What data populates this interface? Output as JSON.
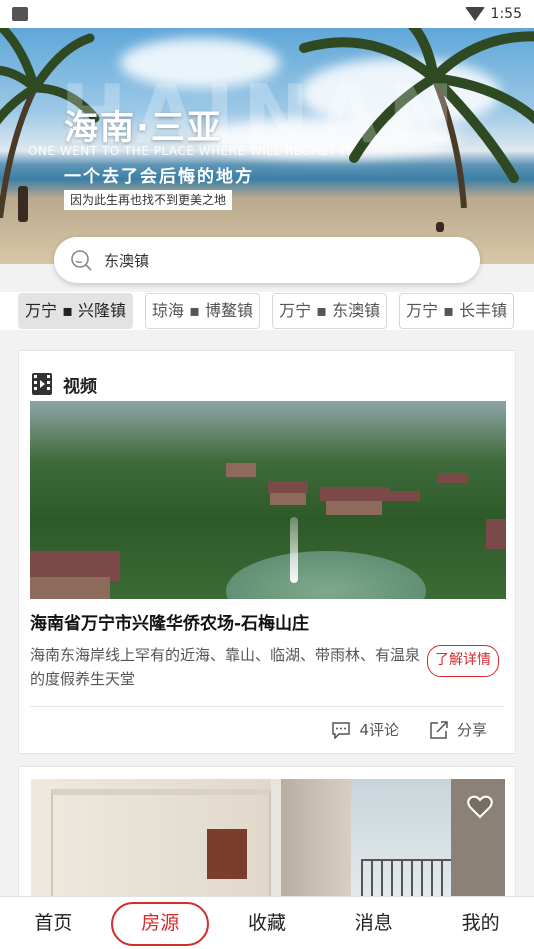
{
  "status_bar": {
    "time": "1:55"
  },
  "hero": {
    "bg_text": "HAINAN",
    "title": "海南·三亚",
    "english": "ONE WENT TO THE PLACE WHERE WILL REGRET IT",
    "subtitle": "一个去了会后悔的地方",
    "tag": "因为此生再也找不到更美之地"
  },
  "search": {
    "value": "东澳镇"
  },
  "chips": [
    {
      "label": "万宁 ▪ 兴隆镇",
      "active": true
    },
    {
      "label": "琼海 ▪ 博鳌镇",
      "active": false
    },
    {
      "label": "万宁 ▪ 东澳镇",
      "active": false
    },
    {
      "label": "万宁 ▪ 长丰镇",
      "active": false
    }
  ],
  "video_card": {
    "section_label": "视频",
    "title": "海南省万宁市兴隆华侨农场-石梅山庄",
    "description": "海南东海岸线上罕有的近海、靠山、临湖、带雨林、有温泉的度假养生天堂",
    "detail_button": "了解详情",
    "comments": "4评论",
    "share": "分享"
  },
  "tabbar": {
    "items": [
      {
        "label": "首页"
      },
      {
        "label": "房源"
      },
      {
        "label": "收藏"
      },
      {
        "label": "消息"
      },
      {
        "label": "我的"
      }
    ],
    "active_index": 1
  },
  "colors": {
    "accent": "#d42b2b",
    "background": "#f2f2f2"
  },
  "icons": [
    "wifi-icon",
    "search-icon",
    "film-icon",
    "comment-icon",
    "share-icon",
    "heart-icon"
  ]
}
